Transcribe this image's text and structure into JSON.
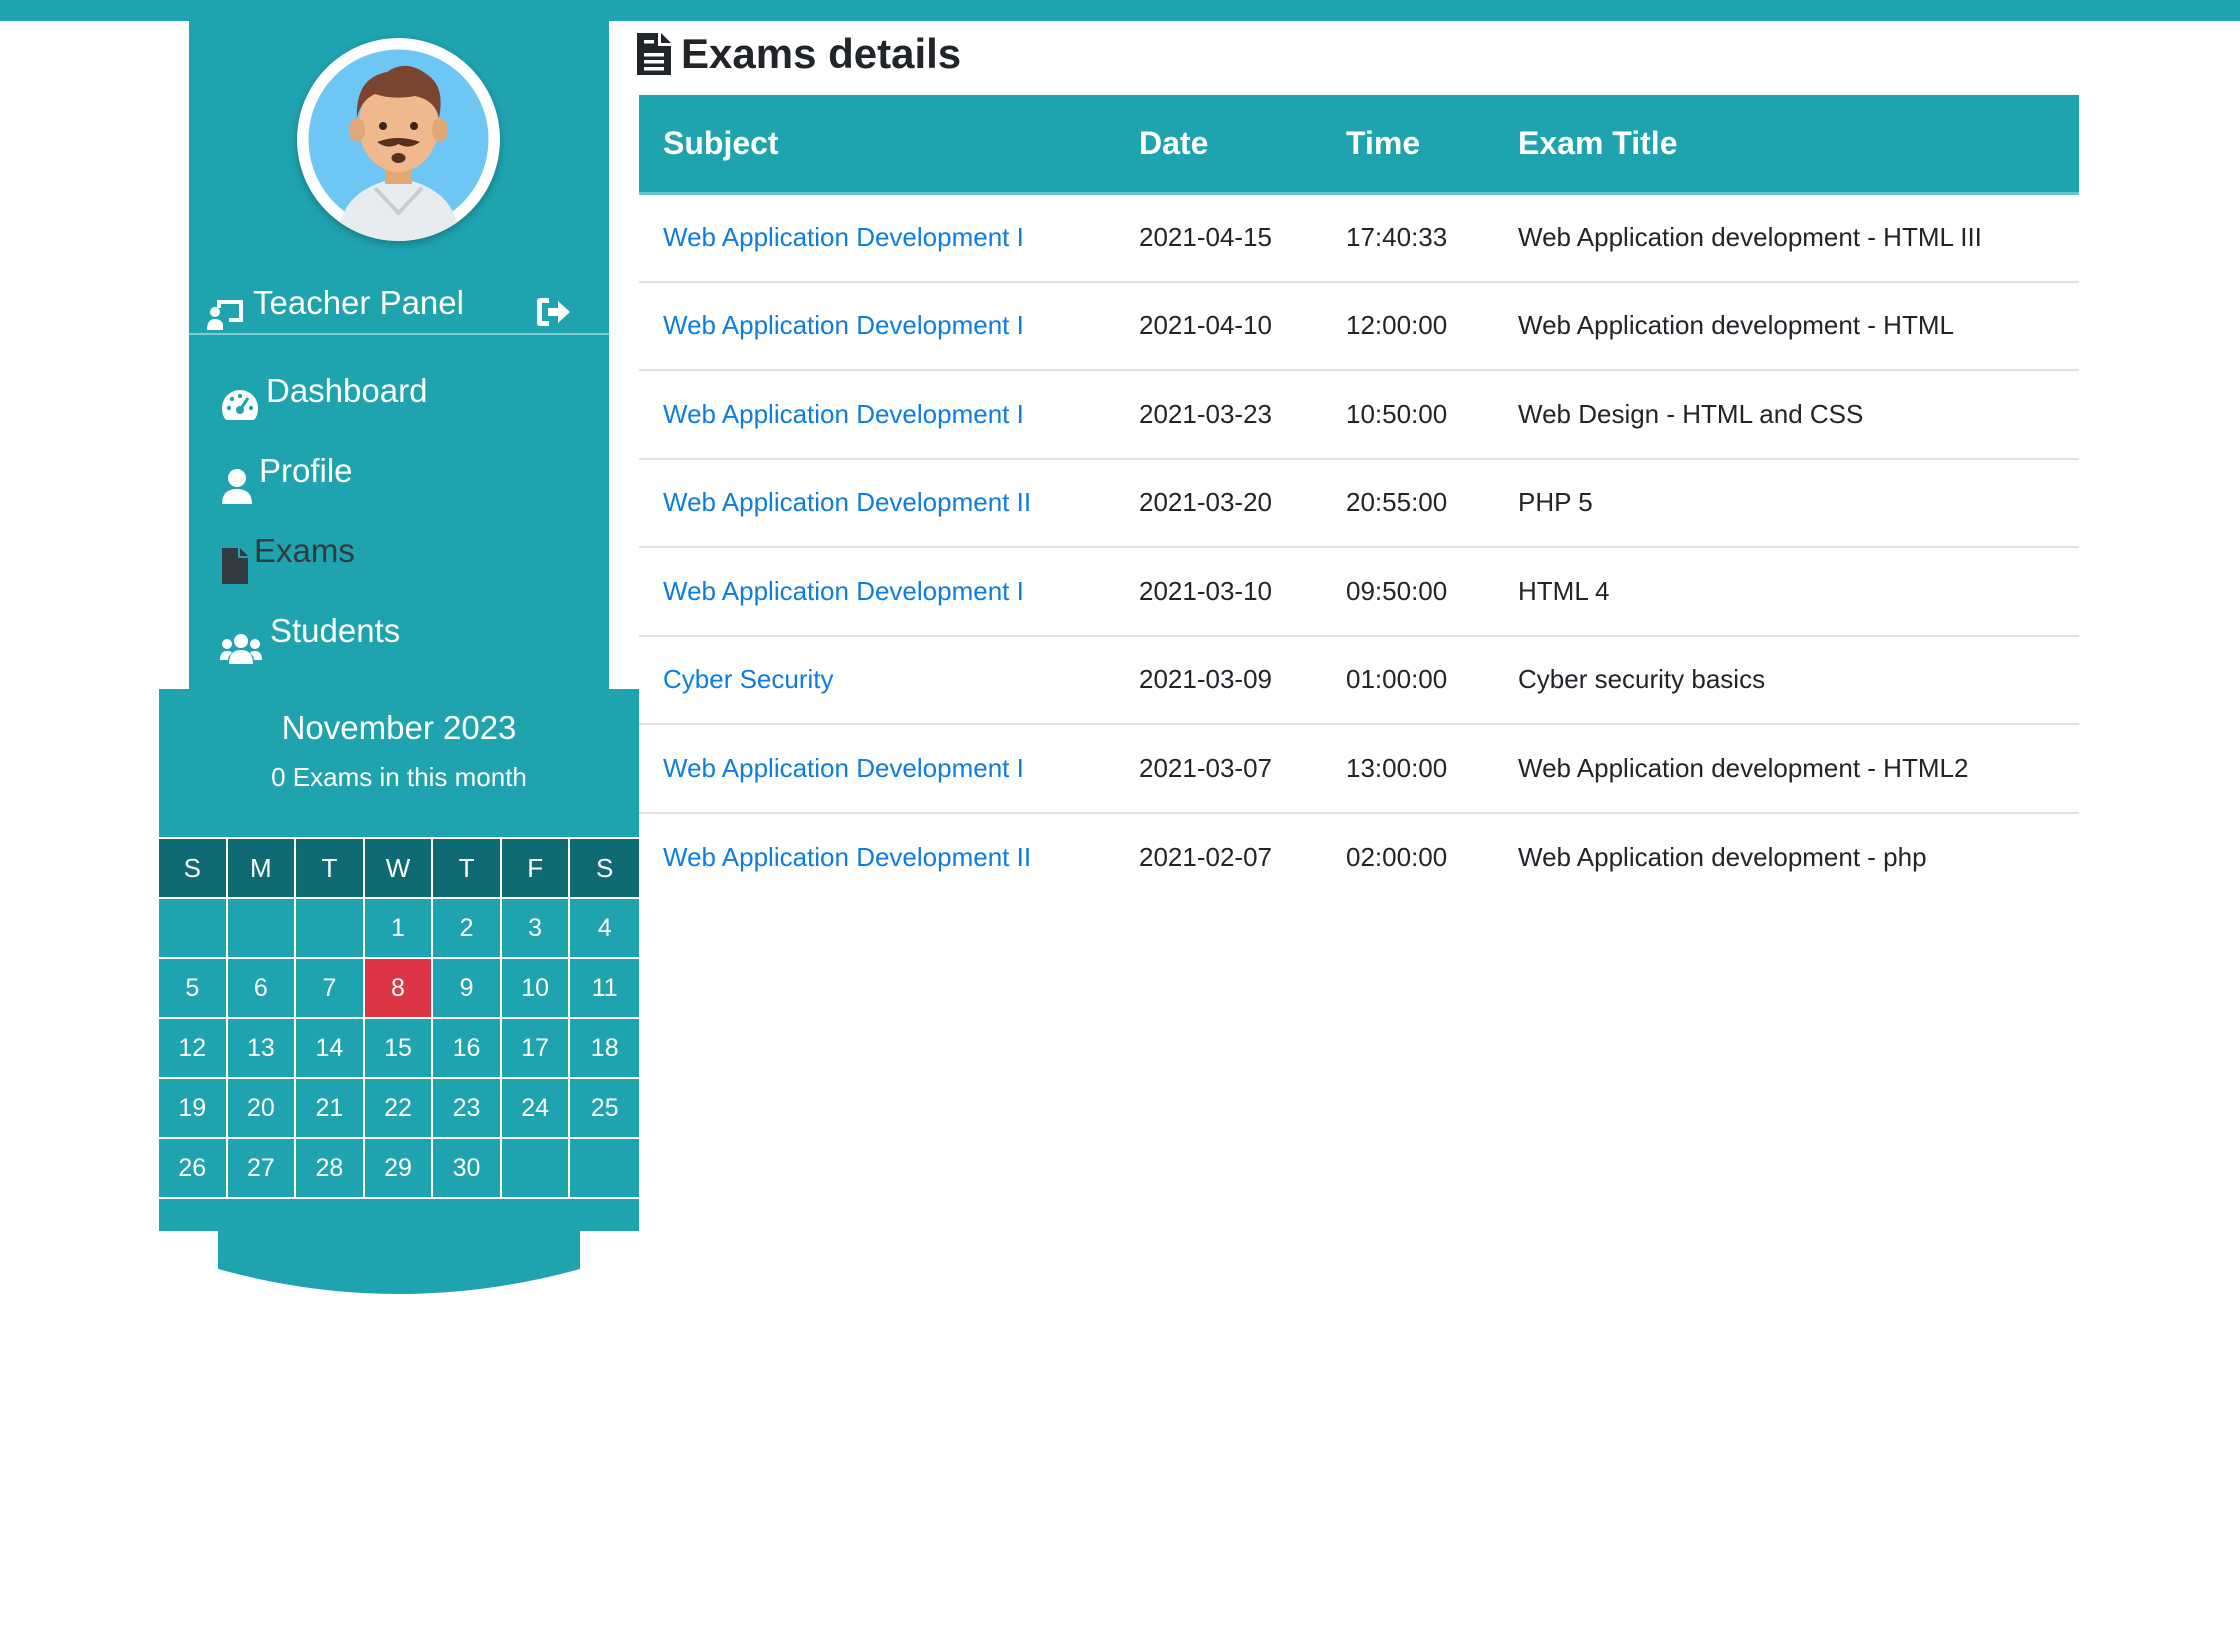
{
  "colors": {
    "accent": "#1ea3af",
    "accent_dark": "#0f6a74",
    "today": "#dc3545",
    "link": "#0d7de0"
  },
  "sidebar": {
    "avatar_icon": "teacher-avatar",
    "panel_title": "Teacher Panel",
    "panel_icon": "chalkboard-teacher-icon",
    "logout_icon": "sign-out-icon",
    "items": [
      {
        "label": "Dashboard",
        "icon": "tachometer-icon",
        "active": false
      },
      {
        "label": "Profile",
        "icon": "user-icon",
        "active": false
      },
      {
        "label": "Exams",
        "icon": "file-icon",
        "active": true
      },
      {
        "label": "Students",
        "icon": "users-icon",
        "active": false
      }
    ]
  },
  "calendar": {
    "month_label": "November 2023",
    "exam_count_label": "0 Exams in this month",
    "weekdays": [
      "S",
      "M",
      "T",
      "W",
      "T",
      "F",
      "S"
    ],
    "days": [
      "",
      "",
      "",
      "1",
      "2",
      "3",
      "4",
      "5",
      "6",
      "7",
      "8",
      "9",
      "10",
      "11",
      "12",
      "13",
      "14",
      "15",
      "16",
      "17",
      "18",
      "19",
      "20",
      "21",
      "22",
      "23",
      "24",
      "25",
      "26",
      "27",
      "28",
      "29",
      "30",
      "",
      ""
    ],
    "today": "8"
  },
  "main": {
    "title": "Exams details",
    "title_icon": "file-alt-icon",
    "columns": [
      "Subject",
      "Date",
      "Time",
      "Exam Title"
    ],
    "rows": [
      [
        "Web Application Development I",
        "2021-04-15",
        "17:40:33",
        "Web Application development - HTML III"
      ],
      [
        "Web Application Development I",
        "2021-04-10",
        "12:00:00",
        "Web Application development - HTML"
      ],
      [
        "Web Application Development I",
        "2021-03-23",
        "10:50:00",
        "Web Design - HTML and CSS"
      ],
      [
        "Web Application Development II",
        "2021-03-20",
        "20:55:00",
        "PHP 5"
      ],
      [
        "Web Application Development I",
        "2021-03-10",
        "09:50:00",
        "HTML 4"
      ],
      [
        "Cyber Security",
        "2021-03-09",
        "01:00:00",
        "Cyber security basics"
      ],
      [
        "Web Application Development I",
        "2021-03-07",
        "13:00:00",
        "Web Application development - HTML2"
      ],
      [
        "Web Application Development II",
        "2021-02-07",
        "02:00:00",
        "Web Application development - php"
      ]
    ]
  }
}
